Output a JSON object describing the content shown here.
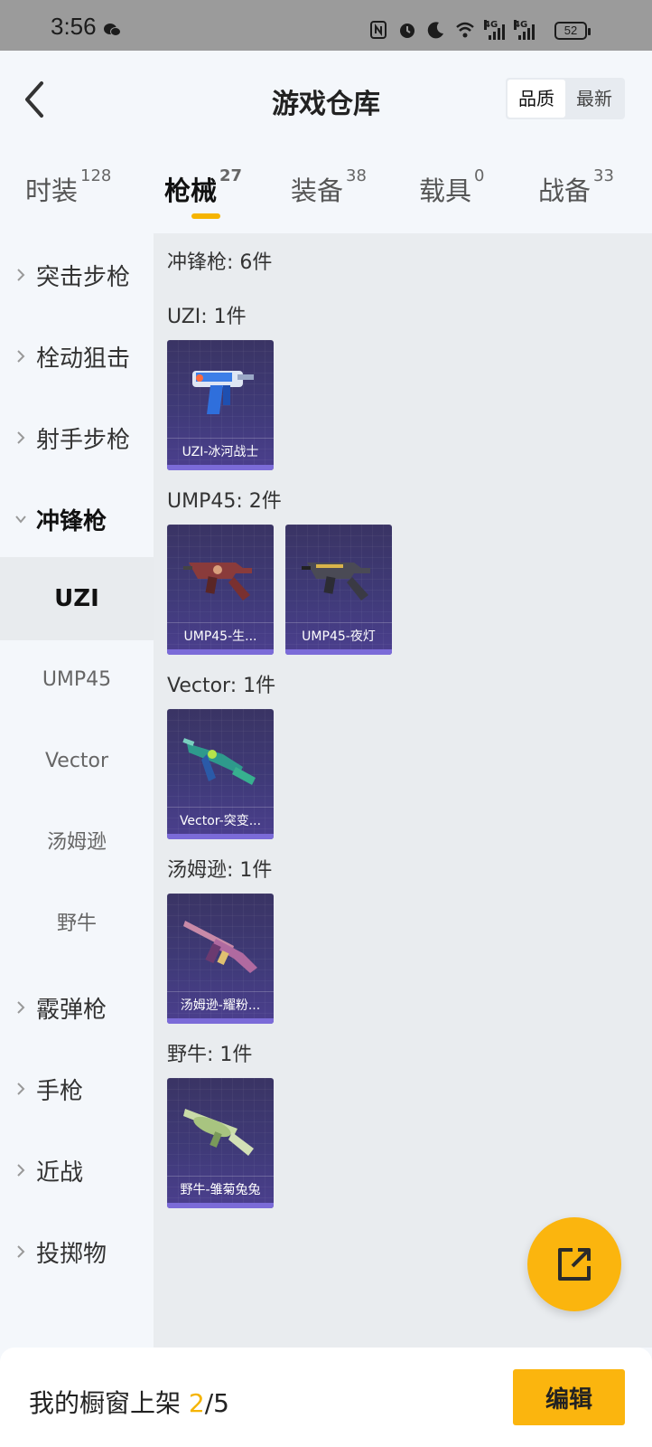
{
  "status_bar": {
    "time": "3:56",
    "battery": "52"
  },
  "header": {
    "title": "游戏仓库",
    "sort": {
      "options": [
        "品质",
        "最新"
      ],
      "selected": "品质"
    }
  },
  "tabs": [
    {
      "label": "时装",
      "count": "128"
    },
    {
      "label": "枪械",
      "count": "27",
      "active": true
    },
    {
      "label": "装备",
      "count": "38"
    },
    {
      "label": "载具",
      "count": "0"
    },
    {
      "label": "战备",
      "count": "33"
    }
  ],
  "sidebar": {
    "categories": [
      "突击步枪",
      "栓动狙击",
      "射手步枪",
      "冲锋枪"
    ],
    "expanded": "冲锋枪",
    "subitems": [
      "UZI",
      "UMP45",
      "Vector",
      "汤姆逊",
      "野牛"
    ],
    "selected_sub": "UZI",
    "more_categories": [
      "霰弹枪",
      "手枪",
      "近战",
      "投掷物"
    ]
  },
  "content": {
    "summary": "冲锋枪: 6件",
    "groups": [
      {
        "title": "UZI: 1件",
        "items": [
          "UZI-冰河战士"
        ]
      },
      {
        "title": "UMP45: 2件",
        "items": [
          "UMP45-生...",
          "UMP45-夜灯"
        ]
      },
      {
        "title": "Vector: 1件",
        "items": [
          "Vector-突变..."
        ]
      },
      {
        "title": "汤姆逊: 1件",
        "items": [
          "汤姆逊-耀粉..."
        ]
      },
      {
        "title": "野牛: 1件",
        "items": [
          "野牛-雏菊兔兔"
        ]
      }
    ]
  },
  "bottom_bar": {
    "label": "我的橱窗上架",
    "count": "2",
    "total": "/5",
    "edit_label": "编辑"
  },
  "colors": {
    "accent": "#fbb50e",
    "card_bg": "#3f3a78",
    "card_bar": "#7b6bd8"
  }
}
